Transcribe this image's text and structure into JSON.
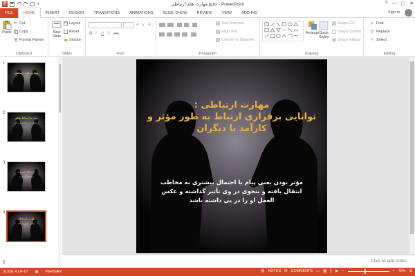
{
  "window": {
    "title": "مهارت های ارتباطی.pptx - PowerPoint",
    "help": "?",
    "minimize": "—",
    "maximize": "▢",
    "close": "✕"
  },
  "tabs": [
    "FILE",
    "HOME",
    "INSERT",
    "DESIGN",
    "TRANSITIONS",
    "ANIMATIONS",
    "SLIDE SHOW",
    "REVIEW",
    "VIEW",
    "ADD-INS"
  ],
  "active_tab": "HOME",
  "account": {
    "sign_in": "Sign in"
  },
  "ribbon": {
    "clipboard": {
      "label": "Clipboard",
      "paste": "Paste",
      "cut": "Cut",
      "copy": "Copy",
      "format_painter": "Format Painter"
    },
    "slides": {
      "label": "Slides",
      "new_slide": "New Slide",
      "layout": "Layout",
      "reset": "Reset",
      "section": "Section"
    },
    "font": {
      "label": "Font",
      "bold": "B",
      "italic": "I",
      "underline": "U",
      "shadow": "S",
      "strike": "abc",
      "grow": "A",
      "shrink": "A",
      "clear": "A"
    },
    "paragraph": {
      "label": "Paragraph",
      "text_direction": "Text Direction",
      "align_text": "Align Text",
      "convert_smartart": "Convert to SmartArt"
    },
    "drawing": {
      "label": "Drawing",
      "arrange": "Arrange",
      "quick_styles": "Quick Styles",
      "shape_fill": "Shape Fill",
      "shape_outline": "Shape Outline",
      "shape_effects": "Shape Effects"
    },
    "editing": {
      "label": "Editing",
      "find": "Find",
      "replace": "Replace",
      "select": "Select"
    }
  },
  "thumbnails": [
    {
      "num": "1",
      "title": "مهارت های ارتباطی",
      "body": ""
    },
    {
      "num": "2",
      "title": "نیاز به ارتباط بخش",
      "body": "ارتباطات امری اساسی در زندگی"
    },
    {
      "num": "3",
      "title": "ارتباط چیست",
      "body": "ارتباط فرآیندی است"
    },
    {
      "num": "4",
      "title": "مهارت ارتباطی",
      "body": "توانایی برقراری ارتباط"
    },
    {
      "num": "5",
      "title": "",
      "body": ""
    }
  ],
  "slide": {
    "title_line1": "مهارت ارتباطی :",
    "title_line2": "توانایی برقراری ارتباط به طور مؤثر و کارآمد با دیگران",
    "body": "مؤثر بودن یعنی پیام با احتمال بیشتری به مخاطب انتقال یافته و بنحوی در وی تأثیر گذاشته و عکس العمل او را در پی داشته باشد"
  },
  "notes_placeholder": "Click to add notes",
  "status": {
    "slide_counter": "SLIDE 4 OF 67",
    "language": "PERSIAN",
    "notes": "NOTES",
    "comments": "COMMENTS",
    "zoom": "70%",
    "zoom_minus": "−",
    "zoom_plus": "+"
  },
  "colors": {
    "accent": "#d24726",
    "title_gold": "#e8b041",
    "slide_bg": "#0c0c0c"
  }
}
